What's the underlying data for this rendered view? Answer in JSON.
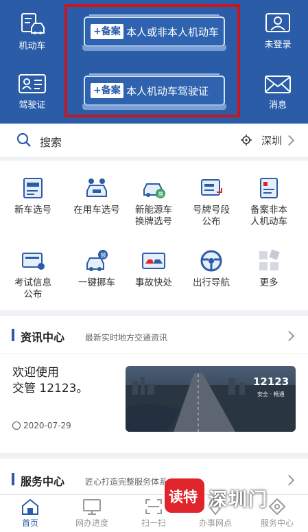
{
  "header": {
    "left_top_label": "机动车",
    "left_bottom_label": "驾驶证",
    "right_top_label": "未登录",
    "right_bottom_label": "消息",
    "register_buttons": [
      {
        "tag": "+备案",
        "text": "本人或非本人机动车"
      },
      {
        "tag": "+备案",
        "text": "本人机动车驾驶证"
      }
    ]
  },
  "search": {
    "label": "搜索",
    "city": "深圳"
  },
  "quick_grid": [
    {
      "label": "新车选号",
      "icon": "new-car-number-icon"
    },
    {
      "label": "在用车选号",
      "icon": "used-car-number-icon"
    },
    {
      "label": "新能源车\n换牌选号",
      "icon": "ev-plate-icon"
    },
    {
      "label": "号牌号段\n公布",
      "icon": "plate-range-icon"
    },
    {
      "label": "备案非本\n人机动车",
      "icon": "register-other-car-icon"
    },
    {
      "label": "考试信息\n公布",
      "icon": "exam-info-icon"
    },
    {
      "label": "一键挪车",
      "icon": "move-car-icon"
    },
    {
      "label": "事故快处",
      "icon": "accident-icon"
    },
    {
      "label": "出行导航",
      "icon": "steering-wheel-icon"
    },
    {
      "label": "更多",
      "icon": "more-icon"
    }
  ],
  "news": {
    "title": "资讯中心",
    "subtitle": "最新实时地方交通资讯",
    "item_title": "欢迎使用\n交管 12123。",
    "item_date": "2020-07-29",
    "image_text": "12123",
    "image_subtext": "安全 · 畅通"
  },
  "service": {
    "title": "服务中心",
    "subtitle": "匠心打造完整服务体系"
  },
  "tabbar": [
    {
      "label": "首页",
      "icon": "home-icon",
      "active": true
    },
    {
      "label": "网办进度",
      "icon": "monitor-icon",
      "active": false
    },
    {
      "label": "扫一扫",
      "icon": "scan-icon",
      "active": false
    },
    {
      "label": "办事网点",
      "icon": "location-icon",
      "active": false
    },
    {
      "label": "服务中心",
      "icon": "service-icon",
      "active": false
    }
  ],
  "watermark": {
    "badge": "读特",
    "text": "深圳门"
  },
  "colors": {
    "primary": "#2a5ca8",
    "highlight_box": "#c8161e",
    "watermark_red": "#e0242c"
  }
}
